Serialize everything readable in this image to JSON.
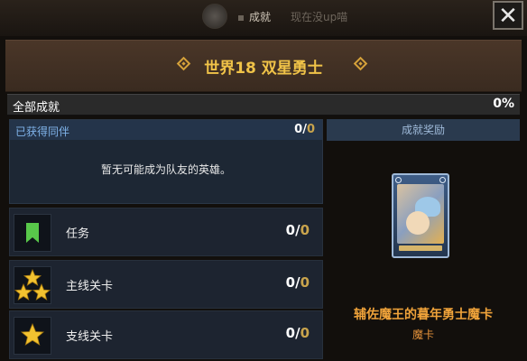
{
  "topbar": {
    "title": "成就",
    "subtitle": "现在没up喵"
  },
  "close": {
    "label": "✕"
  },
  "header": {
    "title": "世界18  双星勇士"
  },
  "summary": {
    "label": "全部成就",
    "percent": "0%"
  },
  "companions": {
    "label": "已获得同伴",
    "count": "0",
    "total": "0",
    "empty_message": "暂无可能成为队友的英雄。"
  },
  "rows": [
    {
      "label": "任务",
      "count": "0",
      "total": "0",
      "icon": "bookmark-icon"
    },
    {
      "label": "主线关卡",
      "count": "0",
      "total": "0",
      "icon": "triple-star-icon"
    },
    {
      "label": "支线关卡",
      "count": "0",
      "total": "0",
      "icon": "star-icon"
    }
  ],
  "reward": {
    "header": "成就奖励",
    "name": "辅佐魔王的暮年勇士魔卡",
    "type": "魔卡"
  },
  "colors": {
    "gold": "#f0c348",
    "accent_blue": "#7fb2e8",
    "reward_orange": "#f0a33a"
  }
}
